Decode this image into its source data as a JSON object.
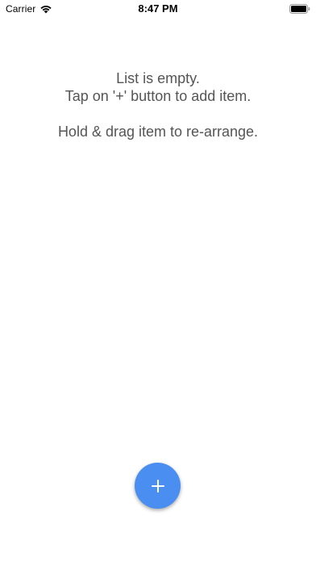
{
  "status_bar": {
    "carrier": "Carrier",
    "time": "8:47 PM",
    "wifi_icon": "wifi-icon",
    "battery_icon": "battery-icon"
  },
  "empty_state": {
    "line1": "List is empty.",
    "line2": "Tap on '+' button to add item.",
    "line3": "Hold & drag item to re-arrange."
  },
  "fab": {
    "icon": "plus-icon",
    "color": "#4a8ef1"
  }
}
